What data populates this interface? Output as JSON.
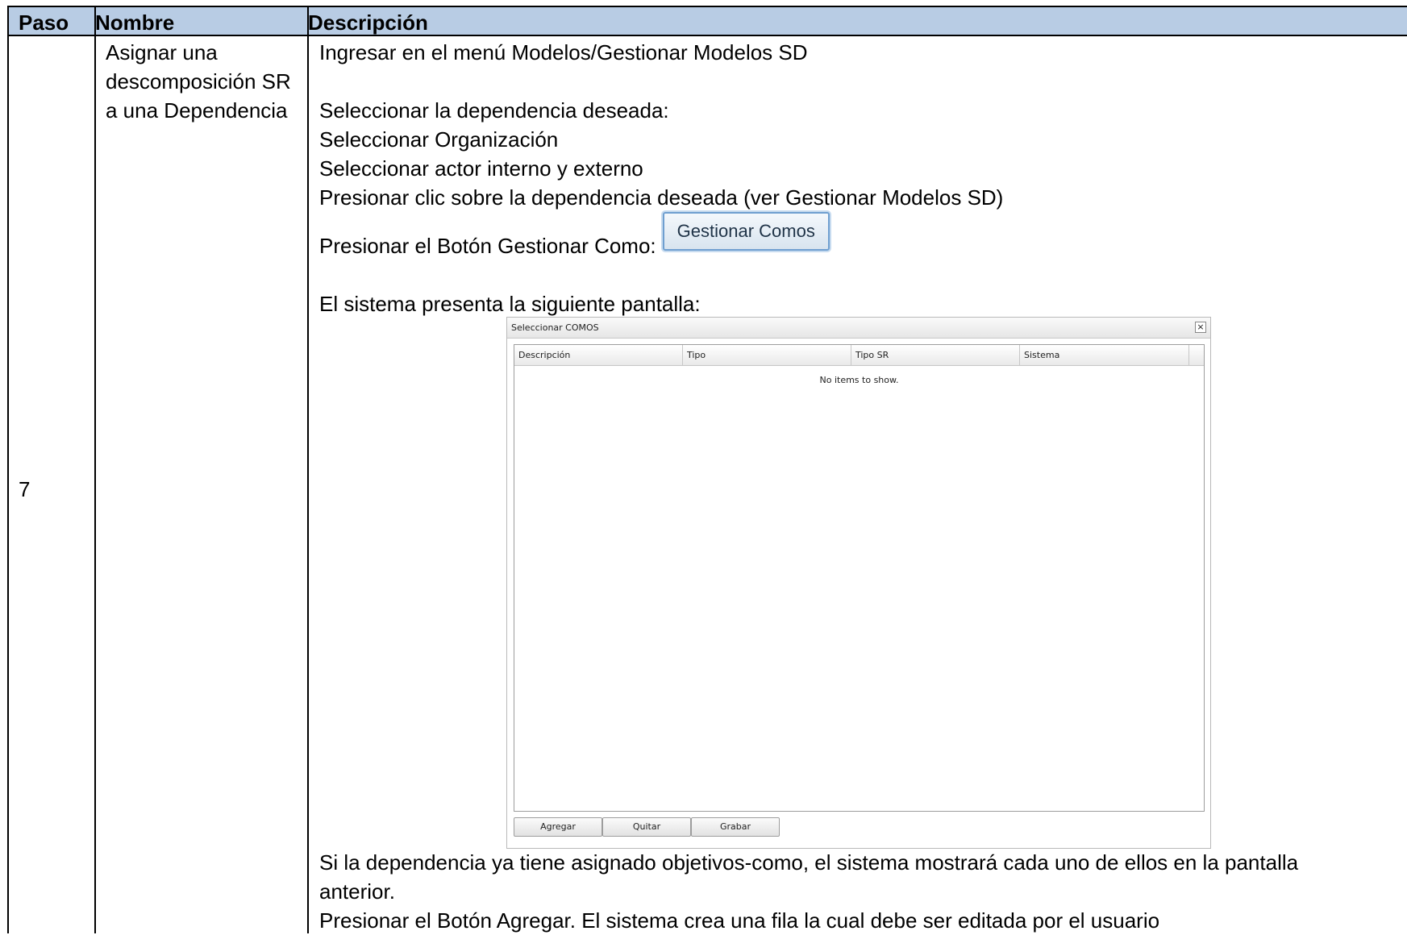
{
  "table": {
    "headers": {
      "paso": "Paso",
      "nombre": "Nombre",
      "descripcion": "Descripción"
    },
    "row": {
      "paso": "7",
      "nombre_lines": [
        "Asignar una",
        "descomposición SR",
        "a una Dependencia"
      ],
      "descripcion": {
        "line1": "Ingresar en el menú Modelos/Gestionar Modelos SD",
        "line2": "Seleccionar la dependencia deseada:",
        "line3": "Seleccionar Organización",
        "line4": "Seleccionar actor interno y externo",
        "line5": "Presionar clic sobre la dependencia deseada (ver Gestionar Modelos SD)",
        "line6": "Presionar el Botón Gestionar Como:",
        "inline_button": "Gestionar Comos",
        "line7": "El sistema presenta la siguiente pantalla:",
        "line8": "Si la dependencia ya tiene asignado objetivos-como, el sistema mostrará cada uno de ellos en la pantalla",
        "line9": "anterior.",
        "line10": "Presionar el Botón Agregar. El sistema crea una fila la cual debe ser editada por el usuario"
      }
    }
  },
  "dialog": {
    "title": "Seleccionar COMOS",
    "columns": [
      "Descripción",
      "Tipo",
      "Tipo SR",
      "Sistema"
    ],
    "empty_message": "No items to show.",
    "buttons": {
      "agregar": "Agregar",
      "quitar": "Quitar",
      "grabar": "Grabar"
    }
  },
  "colors": {
    "header_bg": "#b8cce4",
    "button_border": "#6f9fd0"
  }
}
